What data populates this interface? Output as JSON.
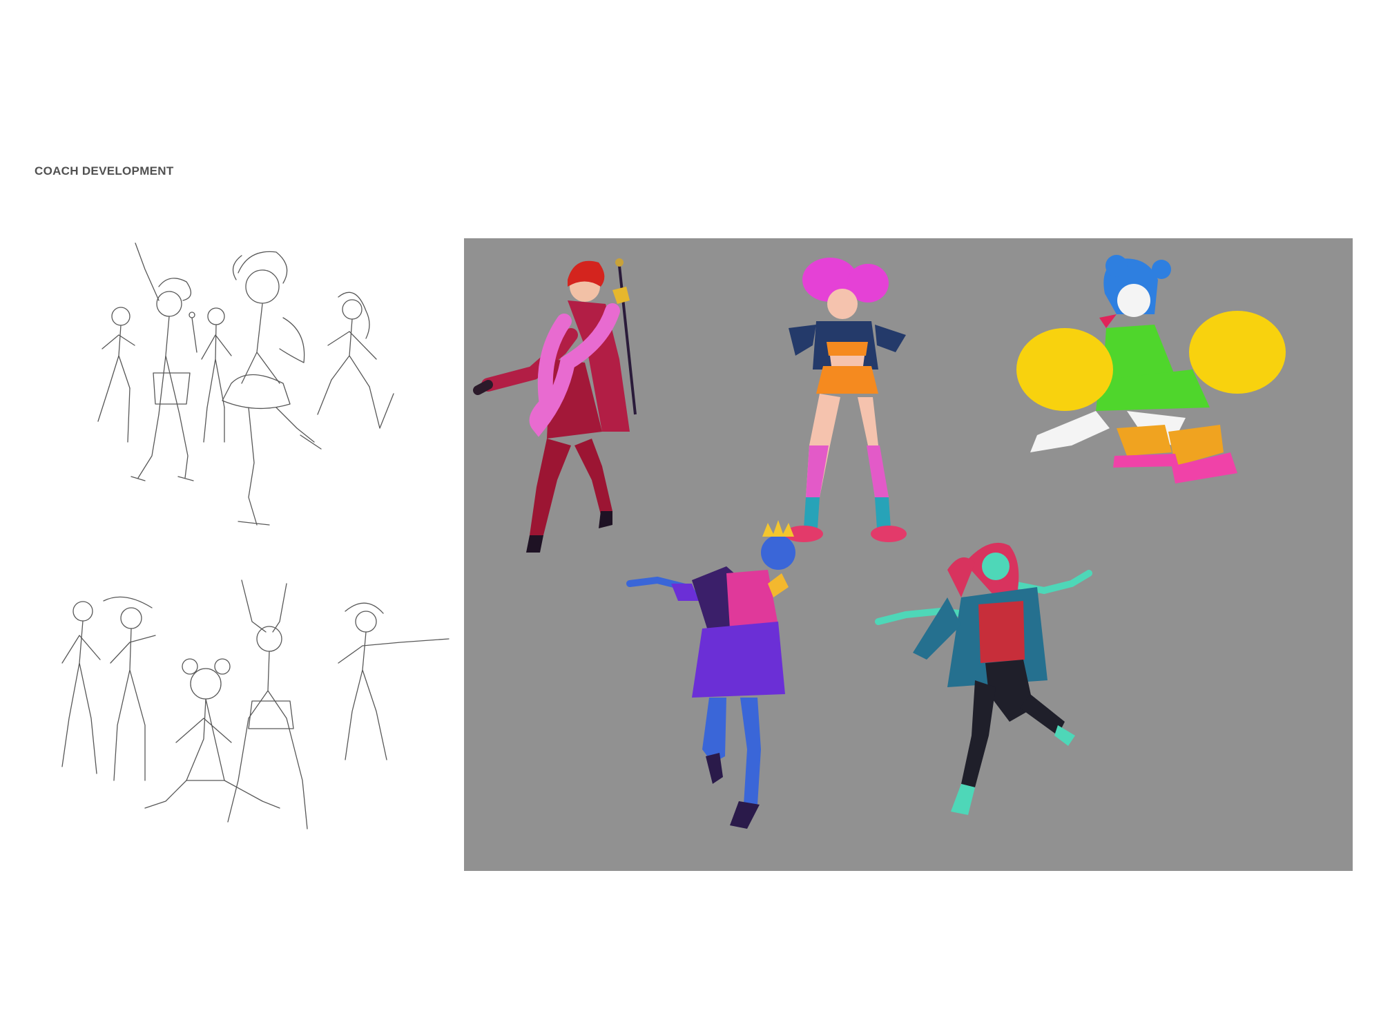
{
  "page": {
    "title": "COACH DEVELOPMENT"
  },
  "colors": {
    "title_text": "#505050",
    "panel_background": "#919191",
    "sketch_line": "#3a3a3a",
    "coach_red_suit": "#b21e45",
    "coach_pink_boa": "#e86bd0",
    "coach_orange_outfit": "#f58a1f",
    "coach_magenta_hair": "#e541d6",
    "coach_blue_hair": "#2e7fe0",
    "coach_green_top": "#4fd62c",
    "coach_yellow_pompom": "#f8d20e",
    "coach_purple_king": "#6b2fd6",
    "coach_blue_skin": "#3a66d8",
    "coach_teal_skin": "#4ed7b8",
    "coach_red_hair": "#d8335e"
  },
  "coaches": [
    {
      "name": "red-suit-coach-icon"
    },
    {
      "name": "orange-outfit-coach-icon"
    },
    {
      "name": "cheerleader-coach-icon"
    },
    {
      "name": "king-coach-icon"
    },
    {
      "name": "teal-skin-coach-icon"
    }
  ]
}
